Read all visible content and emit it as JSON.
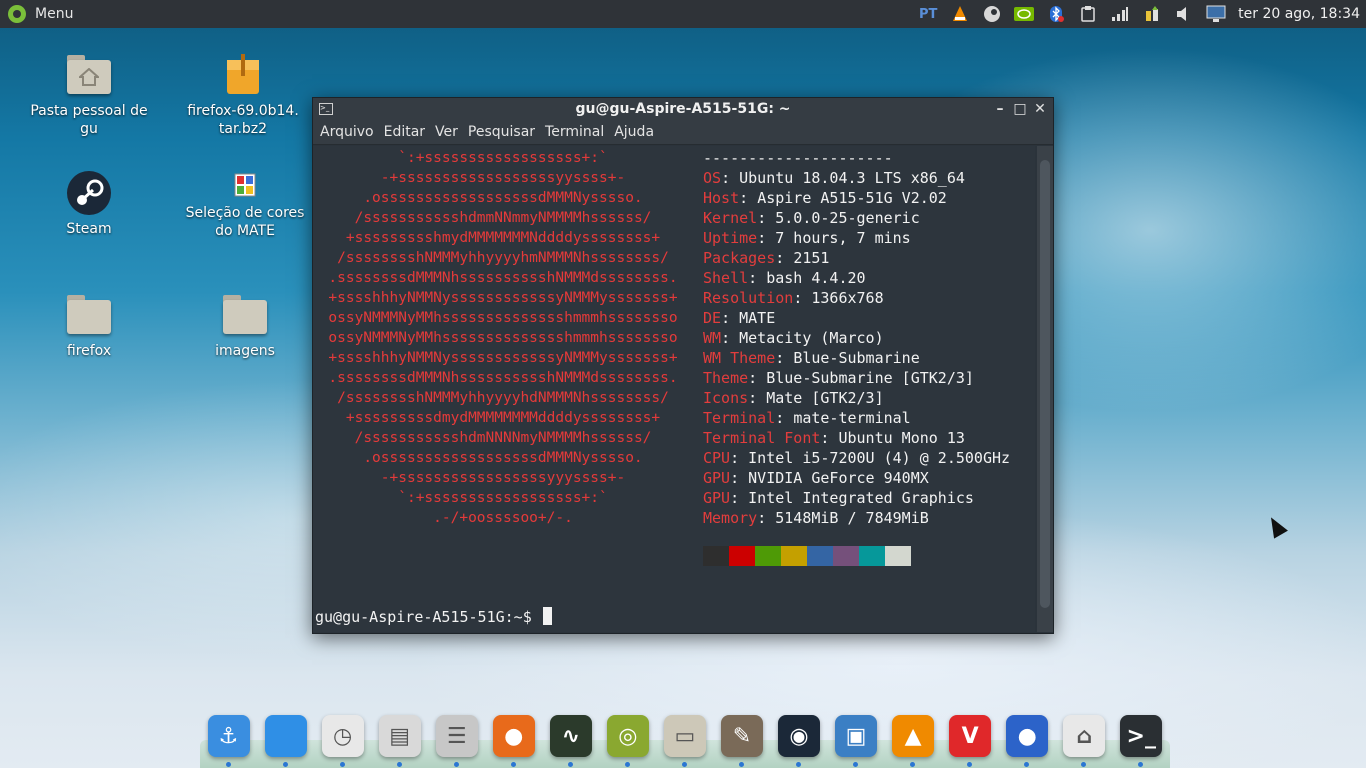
{
  "top_panel": {
    "menu_label": "Menu",
    "keyboard_layout": "PT",
    "clock": "ter 20 ago, 18:34",
    "tray_icons": [
      "vlc-icon",
      "steam-icon",
      "nvidia-icon",
      "bluetooth-icon",
      "clipboard-icon",
      "network-signal-icon",
      "updates-icon",
      "volume-icon",
      "display-icon"
    ]
  },
  "desktop_icons": [
    {
      "label": "Pasta pessoal de gu",
      "icon": "home-folder-icon"
    },
    {
      "label": "firefox-69.0b14.tar.bz2",
      "icon": "archive-icon"
    },
    {
      "label": "Steam",
      "icon": "steam-icon"
    },
    {
      "label": "Seleção de cores do MATE",
      "icon": "color-selector-icon"
    },
    {
      "label": "firefox",
      "icon": "folder-icon"
    },
    {
      "label": "imagens",
      "icon": "folder-icon"
    }
  ],
  "terminal": {
    "title": "gu@gu-Aspire-A515-51G: ~",
    "menu": [
      "Arquivo",
      "Editar",
      "Ver",
      "Pesquisar",
      "Terminal",
      "Ajuda"
    ],
    "logo_lines": [
      "`:+ssssssssssssssssss+:`",
      "-+ssssssssssssssssssyyssss+-",
      ".ossssssssssssssssssdMMMNysssso.",
      "/ssssssssssshdmmNNmmyNMMMMhssssss/",
      "+ssssssssshmydMMMMMMMNddddyssssssss+",
      "/sssssssshNMMMyhhyyyyhmNMMMNhssssssss/",
      ".ssssssssdMMMNhsssssssssshNMMMdssssssss.",
      "+sssshhhyNMMNyssssssssssssyNMMMysssssss+",
      "ossyNMMMNyMMhsssssssssssssshmmmhssssssso",
      "ossyNMMMNyMMhsssssssssssssshmmmhssssssso",
      "+sssshhhyNMMNyssssssssssssyNMMMysssssss+",
      ".ssssssssdMMMNhsssssssssshNMMMdssssssss.",
      "/sssssssshNMMMyhhyyyyhdNMMMNhssssssss/",
      "+sssssssssdmydMMMMMMMMddddyssssssss+",
      "/ssssssssssshdmNNNNmyNMMMMhssssss/",
      ".ossssssssssssssssssdMMMNysssso.",
      "-+sssssssssssssssssyyyssss+-",
      "`:+ssssssssssssssssss+:`",
      ".-/+oossssoo+/-."
    ],
    "separator": "---------------------",
    "info": [
      {
        "key": "OS",
        "value": "Ubuntu 18.04.3 LTS x86_64"
      },
      {
        "key": "Host",
        "value": "Aspire A515-51G V2.02"
      },
      {
        "key": "Kernel",
        "value": "5.0.0-25-generic"
      },
      {
        "key": "Uptime",
        "value": "7 hours, 7 mins"
      },
      {
        "key": "Packages",
        "value": "2151"
      },
      {
        "key": "Shell",
        "value": "bash 4.4.20"
      },
      {
        "key": "Resolution",
        "value": "1366x768"
      },
      {
        "key": "DE",
        "value": "MATE"
      },
      {
        "key": "WM",
        "value": "Metacity (Marco)"
      },
      {
        "key": "WM Theme",
        "value": "Blue-Submarine"
      },
      {
        "key": "Theme",
        "value": "Blue-Submarine [GTK2/3]"
      },
      {
        "key": "Icons",
        "value": "Mate [GTK2/3]"
      },
      {
        "key": "Terminal",
        "value": "mate-terminal"
      },
      {
        "key": "Terminal Font",
        "value": "Ubuntu Mono 13"
      },
      {
        "key": "CPU",
        "value": "Intel i5-7200U (4) @ 2.500GHz"
      },
      {
        "key": "GPU",
        "value": "NVIDIA GeForce 940MX"
      },
      {
        "key": "GPU",
        "value": "Intel Integrated Graphics"
      },
      {
        "key": "Memory",
        "value": "5148MiB / 7849MiB"
      }
    ],
    "palette": [
      "#2e2e2e",
      "#cc0000",
      "#4e9a06",
      "#c4a000",
      "#3465a4",
      "#75507b",
      "#06989a",
      "#d3d7cf"
    ],
    "prompt": "gu@gu-Aspire-A515-51G:~$"
  },
  "dock": [
    {
      "name": "anchor-icon",
      "color": "#3a8ee0",
      "glyph": "⚓"
    },
    {
      "name": "show-desktop-icon",
      "color": "#2f8fe6",
      "glyph": ""
    },
    {
      "name": "clock-icon",
      "color": "#e8e8e8",
      "glyph": "◷"
    },
    {
      "name": "file-cabinet-icon",
      "color": "#d9d9d9",
      "glyph": "▤"
    },
    {
      "name": "settings-panel-icon",
      "color": "#c7c7c7",
      "glyph": "☰"
    },
    {
      "name": "firefox-icon",
      "color": "#e86a1b",
      "glyph": "●"
    },
    {
      "name": "system-monitor-icon",
      "color": "#2b3a2b",
      "glyph": "∿"
    },
    {
      "name": "ubuntu-software-icon",
      "color": "#8aa830",
      "glyph": "◎"
    },
    {
      "name": "files-icon",
      "color": "#cdc8b8",
      "glyph": "▭"
    },
    {
      "name": "gimp-icon",
      "color": "#7a6a58",
      "glyph": "✎"
    },
    {
      "name": "steam-icon",
      "color": "#1b2838",
      "glyph": "◉"
    },
    {
      "name": "virtualbox-icon",
      "color": "#3b7fc4",
      "glyph": "▣"
    },
    {
      "name": "vlc-icon",
      "color": "#f08a00",
      "glyph": "▲"
    },
    {
      "name": "vivaldi-icon",
      "color": "#e0282a",
      "glyph": "V"
    },
    {
      "name": "firefox-nightly-icon",
      "color": "#2c63c9",
      "glyph": "●"
    },
    {
      "name": "store-bag-icon",
      "color": "#e8e8e8",
      "glyph": "⌂"
    },
    {
      "name": "terminal-icon",
      "color": "#2a2f33",
      "glyph": ">_"
    }
  ]
}
